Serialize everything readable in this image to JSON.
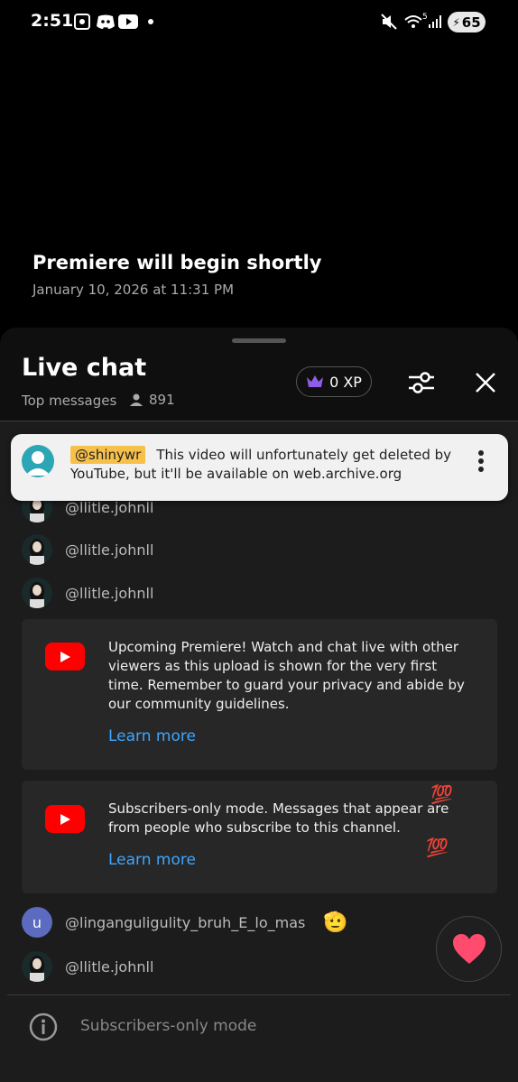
{
  "status_bar": {
    "time": "2:51",
    "battery": "65",
    "wifi_label": "5"
  },
  "video": {
    "title": "Premiere will begin shortly",
    "date": "January 10, 2026 at 11:31 PM"
  },
  "chat_header": {
    "title": "Live chat",
    "mode": "Top messages",
    "viewer_count": "891",
    "xp_label": "0 XP"
  },
  "pinned": {
    "author": "@shinywr",
    "text": "This video will unfortunately get deleted by YouTube, but it'll be available on web.archive.org"
  },
  "messages_top": [
    {
      "author": "@llitle.johnll"
    },
    {
      "author": "@llitle.johnll"
    },
    {
      "author": "@llitle.johnll"
    }
  ],
  "cards": [
    {
      "text": "Upcoming Premiere! Watch and chat live with other viewers as this upload is shown for the very first time. Remember to guard your privacy and abide by our community guidelines.",
      "link": "Learn more"
    },
    {
      "text": "Subscribers-only mode. Messages that appear are from people who subscribe to this channel.",
      "link": "Learn more"
    }
  ],
  "messages_bottom": [
    {
      "author": "@linganguligulity_bruh_E_lo_mas",
      "avatar_letter": "u",
      "emoji": "🫡"
    },
    {
      "author": "@llitle.johnll"
    }
  ],
  "input": {
    "placeholder": "Subscribers-only mode"
  },
  "colors": {
    "accent_link": "#3ea6ff",
    "yt_red": "#ff0000",
    "pin_highlight": "#f7c04a"
  }
}
